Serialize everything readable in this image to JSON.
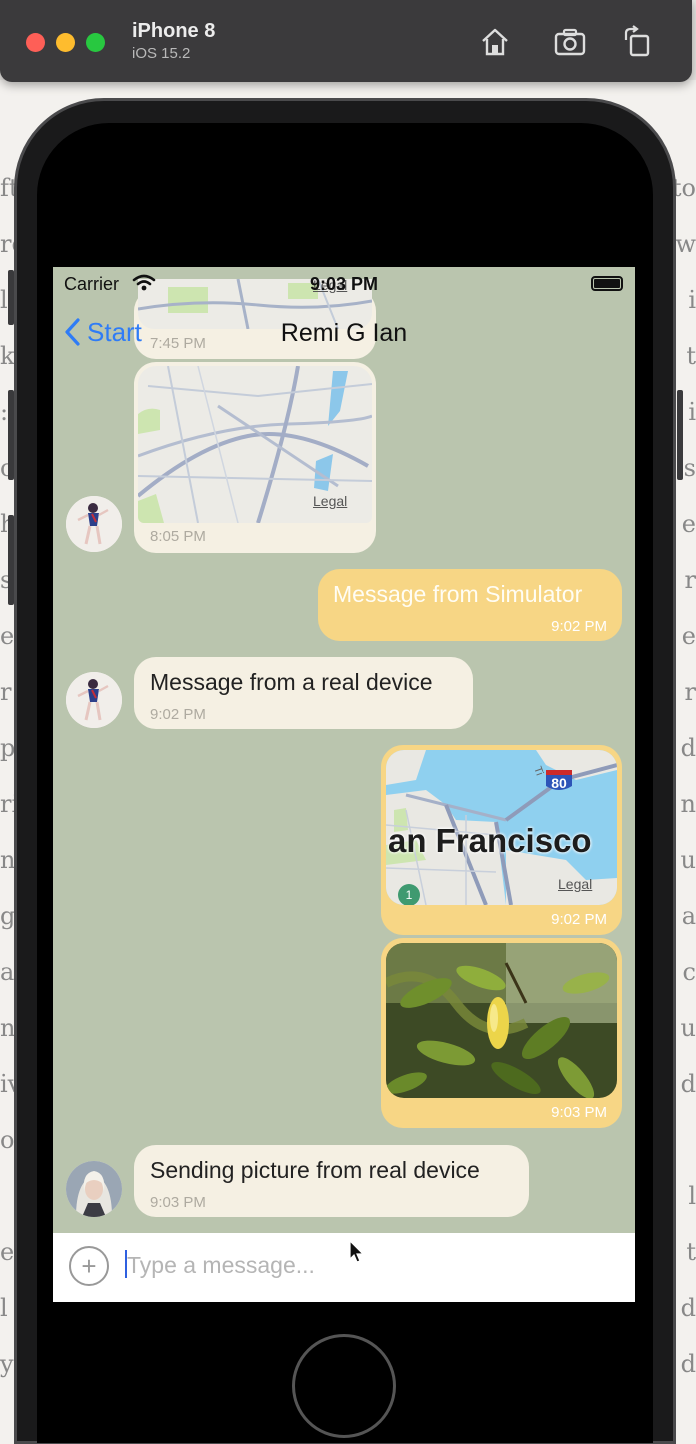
{
  "simulator": {
    "device_name": "iPhone 8",
    "os_version": "iOS 15.2",
    "buttons": [
      "home-icon",
      "screenshot-icon",
      "rotate-icon"
    ]
  },
  "status_bar": {
    "carrier": "Carrier",
    "time": "9:03 PM"
  },
  "nav": {
    "back_label": "Start",
    "title": "Remi G Ian"
  },
  "messages": {
    "map1": {
      "time": "7:45 PM",
      "legal": "Legal"
    },
    "map2": {
      "time": "8:05 PM",
      "legal": "Legal"
    },
    "sim_text": {
      "text": "Message from Simulator",
      "time": "9:02 PM"
    },
    "real_text": {
      "text": "Message from a real device",
      "time": "9:02 PM"
    },
    "sf_map": {
      "city": "an Francisco",
      "highway": "80",
      "route": "1",
      "legal": "Legal",
      "time": "9:02 PM"
    },
    "photo": {
      "time": "9:03 PM"
    },
    "picture_text": {
      "text": "Sending picture from real device",
      "time": "9:03 PM"
    }
  },
  "composer": {
    "placeholder": "Type a message..."
  },
  "colors": {
    "chat_background": "#bac5ae",
    "incoming_bubble": "#f5f0e3",
    "outgoing_bubble": "#f7d685",
    "accent": "#2f7cf6"
  }
}
